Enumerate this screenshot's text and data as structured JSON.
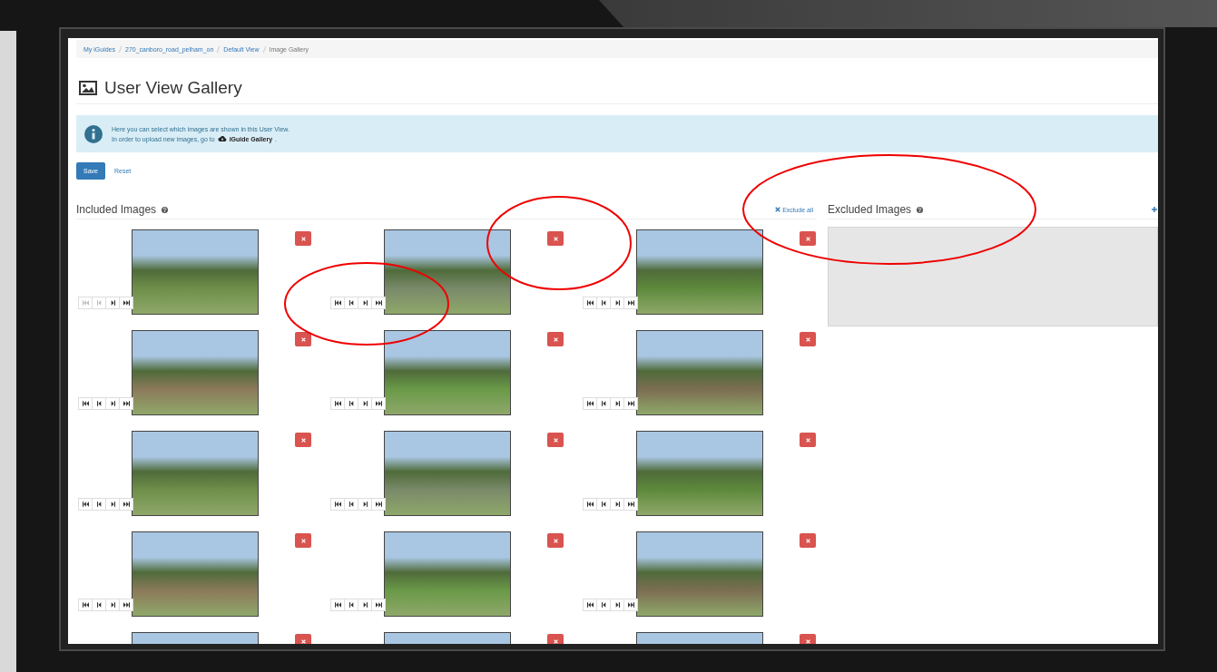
{
  "breadcrumb": [
    {
      "label": "My iGuides",
      "link": true
    },
    {
      "label": "270_canboro_road_pelham_on",
      "link": true
    },
    {
      "label": "Default View",
      "link": true
    },
    {
      "label": "Image Gallery",
      "link": false
    }
  ],
  "page_title": "User View Gallery",
  "info": {
    "line1": "Here you can select which images are shown in this User View.",
    "line2_prefix": "In order to upload new images, go to",
    "link": "iGuide Gallery",
    "line2_suffix": "."
  },
  "buttons": {
    "save": "Save",
    "reset": "Reset"
  },
  "included": {
    "title": "Included Images",
    "action": "Exclude all",
    "images": [
      {
        "kind": "full",
        "at_start": true
      },
      {
        "kind": "full",
        "at_start": false
      },
      {
        "kind": "full",
        "at_start": false
      },
      {
        "kind": "full",
        "at_start": false
      },
      {
        "kind": "full",
        "at_start": false
      },
      {
        "kind": "full",
        "at_start": false
      },
      {
        "kind": "full",
        "at_start": false
      },
      {
        "kind": "full",
        "at_start": false
      },
      {
        "kind": "full",
        "at_start": false
      },
      {
        "kind": "full",
        "at_start": false
      },
      {
        "kind": "full",
        "at_start": false
      },
      {
        "kind": "full",
        "at_start": false
      },
      {
        "kind": "cut"
      },
      {
        "kind": "cut"
      },
      {
        "kind": "cut"
      }
    ]
  },
  "excluded": {
    "title": "Excluded Images"
  }
}
